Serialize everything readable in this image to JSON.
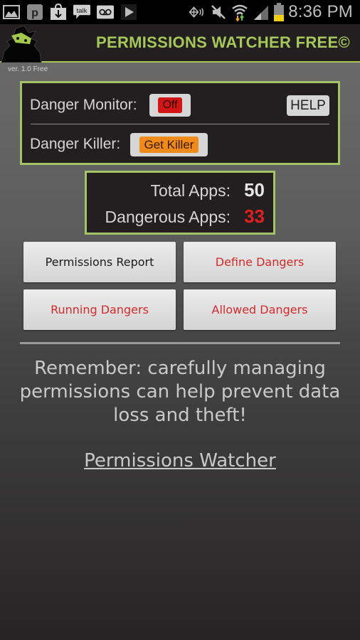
{
  "status_bar": {
    "left_icons": [
      "gallery-icon",
      "p-app-icon",
      "download-icon",
      "talk-icon",
      "voicemail-icon",
      "play-store-icon"
    ],
    "right_icons": [
      "nfc-icon",
      "mute-icon",
      "wifi-icon",
      "signal-icon",
      "battery-icon"
    ],
    "time": "8:36 PM",
    "battery_level": 0.3
  },
  "header": {
    "title": "PERMISSIONS WATCHER FREE©",
    "version": "ver. 1.0 Free",
    "accent_color": "#a6c85a"
  },
  "monitor": {
    "danger_monitor_label": "Danger Monitor:",
    "danger_monitor_state": "Off",
    "help_label": "HELP",
    "danger_killer_label": "Danger Killer:",
    "get_killer_label": "Get Killer"
  },
  "stats": {
    "total_apps_label": "Total Apps:",
    "total_apps": "50",
    "dangerous_apps_label": "Dangerous Apps:",
    "dangerous_apps": "33",
    "danger_color": "#e02020"
  },
  "buttons": {
    "permissions_report": "Permissions Report",
    "define_dangers": "Define Dangers",
    "running_dangers": "Running Dangers",
    "allowed_dangers": "Allowed Dangers"
  },
  "reminder": "Remember: carefully managing permissions can help prevent data loss and theft!",
  "footer_link": "Permissions Watcher"
}
